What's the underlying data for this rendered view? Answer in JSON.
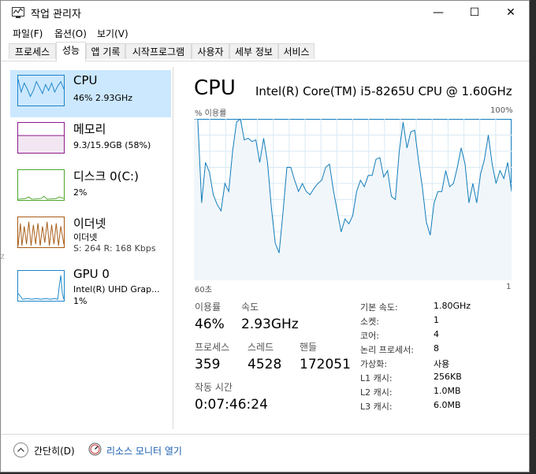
{
  "window": {
    "title": "작업 관리자",
    "minimize": "—",
    "maximize": "☐",
    "close": "✕"
  },
  "menu": [
    "파일(F)",
    "옵션(O)",
    "보기(V)"
  ],
  "tabs": [
    "프로세스",
    "성능",
    "앱 기록",
    "시작프로그램",
    "사용자",
    "세부 정보",
    "서비스"
  ],
  "active_tab": "성능",
  "sidebar": [
    {
      "name": "CPU",
      "sub1": "46%  2.93GHz",
      "sub2": "",
      "color": "#1a84c8"
    },
    {
      "name": "메모리",
      "sub1": "9.3/15.9GB (58%)",
      "sub2": "",
      "color": "#8b1a8b"
    },
    {
      "name": "디스크 0(C:)",
      "sub1": "2%",
      "sub2": "",
      "color": "#4da62b"
    },
    {
      "name": "이더넷",
      "sub1": "이더넷",
      "sub2": "S: 264  R: 168 Kbps",
      "color": "#a75a14"
    },
    {
      "name": "GPU 0",
      "sub1": "Intel(R) UHD Grap...",
      "sub2": "1%",
      "color": "#1a84c8"
    }
  ],
  "detail": {
    "title": "CPU",
    "model": "Intel(R) Core(TM) i5-8265U CPU @ 1.60GHz",
    "graph_label": "% 이용률",
    "graph_max": "100%",
    "graph_left": "60초",
    "graph_right": "1",
    "usage_label": "이용률",
    "usage_value": "46%",
    "speed_label": "속도",
    "speed_value": "2.93GHz",
    "proc_label": "프로세스",
    "proc_value": "359",
    "thread_label": "스레드",
    "thread_value": "4528",
    "handle_label": "핸들",
    "handle_value": "172051",
    "uptime_label": "작동 시간",
    "uptime_value": "0:07:46:24",
    "specs": [
      {
        "k": "기본 속도:",
        "v": "1.80GHz"
      },
      {
        "k": "소켓:",
        "v": "1"
      },
      {
        "k": "코어:",
        "v": "4"
      },
      {
        "k": "논리 프로세서:",
        "v": "8"
      },
      {
        "k": "가상화:",
        "v": "사용"
      },
      {
        "k": "L1 캐시:",
        "v": "256KB"
      },
      {
        "k": "L2 캐시:",
        "v": "1.0MB"
      },
      {
        "k": "L3 캐시:",
        "v": "6.0MB"
      }
    ],
    "usage_history": [
      100,
      100,
      48,
      73,
      67,
      53,
      47,
      43,
      60,
      55,
      80,
      98,
      100,
      87,
      88,
      86,
      87,
      73,
      88,
      73,
      45,
      23,
      17,
      42,
      70,
      70,
      62,
      55,
      60,
      55,
      53,
      57,
      60,
      62,
      70,
      72,
      56,
      43,
      30,
      38,
      35,
      40,
      55,
      62,
      58,
      65,
      65,
      75,
      76,
      64,
      68,
      52,
      50,
      80,
      98,
      82,
      92,
      93,
      74,
      57,
      36,
      28,
      48,
      55,
      55,
      68,
      58,
      60,
      70,
      82,
      72,
      48,
      60,
      48,
      66,
      75,
      90,
      72,
      60,
      68,
      63,
      73,
      55
    ]
  },
  "bottom": {
    "fewer": "간단히(D)",
    "resource_monitor": "리소스 모니터 열기"
  },
  "side_stub": "z"
}
